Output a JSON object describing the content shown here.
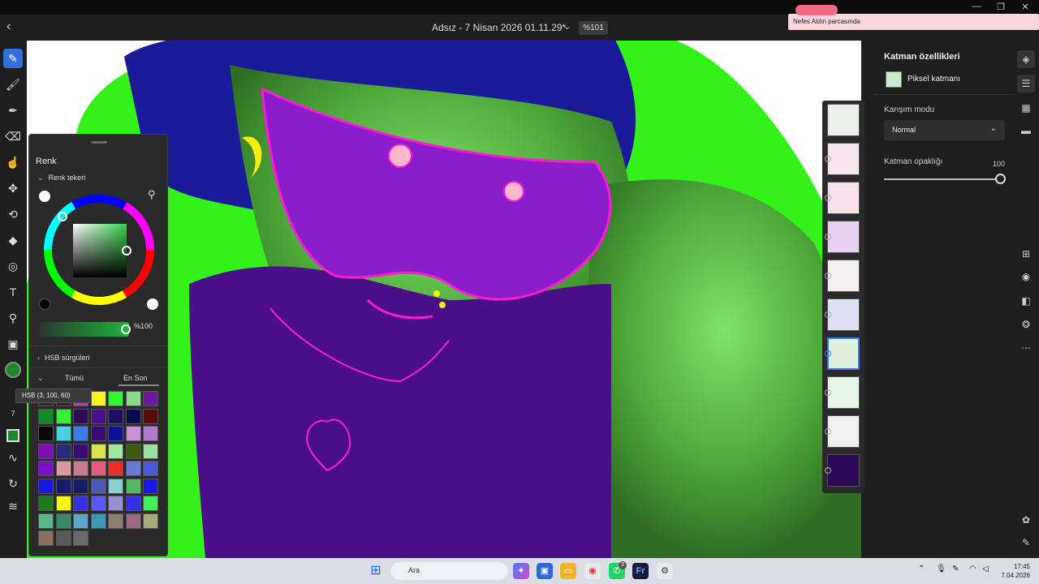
{
  "document": {
    "title": "Adsız - 7 Nisan 2026 01.11.29*",
    "zoom": "%101"
  },
  "notification": {
    "message": "Nefes Aldın parcasında",
    "tag": ""
  },
  "color_panel": {
    "title": "Renk",
    "wheel_section": "Renk tekeri",
    "opacity_value": "%100",
    "hsb_section": "HSB sürgüleri",
    "tab_all": "Tümü",
    "tab_recent": "En Son",
    "tooltip": "HSB (3, 100, 60)",
    "swatches": [
      "#2a2a2a",
      "#2a2a2a",
      "#e81fd4",
      "#f7f51a",
      "#2ef82e",
      "#8bd98b",
      "#6a1aa0",
      "#138a2a",
      "#35f035",
      "#2b0a55",
      "#4b1090",
      "#1d1060",
      "#0a0a50",
      "#5a0a0a",
      "#080808",
      "#4dd0e4",
      "#3a7bf0",
      "#3a0a75",
      "#0f0f9a",
      "#c88fd6",
      "#b07ad0",
      "#7a10b0",
      "#2a2a7a",
      "#3a0a75",
      "#d8e450",
      "#a0e8a0",
      "#3a5a10",
      "#9be0a0",
      "#7a10c8",
      "#d79aa0",
      "#c87a90",
      "#e85a7a",
      "#e83030",
      "#6a7ad0",
      "#4a5ad8",
      "#1a1ae8",
      "#1a1a6a",
      "#1a1a6a",
      "#4a5ab8",
      "#8ad0d0",
      "#56b866",
      "#1a1ae8",
      "#1e7a1e",
      "#f7f51a",
      "#3a30e0",
      "#5a58f8",
      "#9a90d0",
      "#3030e0",
      "#40f058",
      "#5ab888",
      "#3a8a6a",
      "#5aa8c8",
      "#3a9ab8",
      "#8a8070",
      "#9a6a80",
      "#a8a878",
      "#8a7060",
      "#5a5a5a",
      "#6a6a6a"
    ]
  },
  "layer_properties": {
    "title": "Katman özellikleri",
    "layer_type": "Piksel katmanı",
    "blend_label": "Karışım modu",
    "blend_value": "Normal",
    "opacity_label": "Katman opaklığı",
    "opacity_value": "100",
    "opacity_level": 1.0
  },
  "left_toolbar": {
    "brush_size": "7",
    "current_color": "#1a8a2a"
  },
  "taskbar": {
    "search_placeholder": "Ara",
    "time": "17:45",
    "date": "7.04.2026",
    "whatsapp_badge": "3"
  }
}
